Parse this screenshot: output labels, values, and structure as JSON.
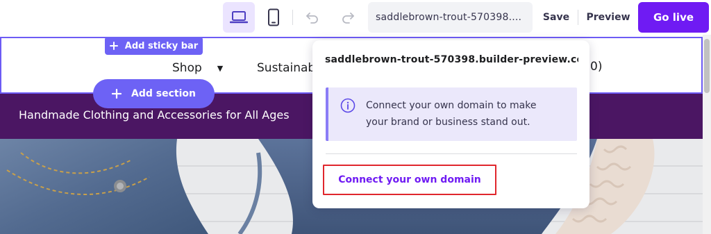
{
  "toolbar": {
    "desktop_icon": "laptop-icon",
    "mobile_icon": "smartphone-icon",
    "undo_icon": "undo-icon",
    "redo_icon": "redo-icon",
    "domain_value": "saddlebrown-trout-570398....",
    "save_label": "Save",
    "preview_label": "Preview",
    "golive_label": "Go live"
  },
  "canvas": {
    "sticky_bar_label": "Add sticky bar",
    "add_section_label": "Add section",
    "nav": {
      "shop_label": "Shop",
      "sustain_label": "Sustainab",
      "paren_text": "0)"
    },
    "hero_text": "Handmade Clothing and Accessories for All Ages"
  },
  "popover": {
    "domain": "saddlebrown-trout-570398.builder-preview.co...",
    "info_line1": "Connect your own domain to make",
    "info_line2": "your brand or business stand out.",
    "connect_label": "Connect your own domain"
  },
  "colors": {
    "accent": "#6f1bf3",
    "builder_blue": "#6d62f5",
    "hero_purple": "#4b1663",
    "info_bg": "#ebe8fb",
    "highlight_red": "#e0262c"
  }
}
